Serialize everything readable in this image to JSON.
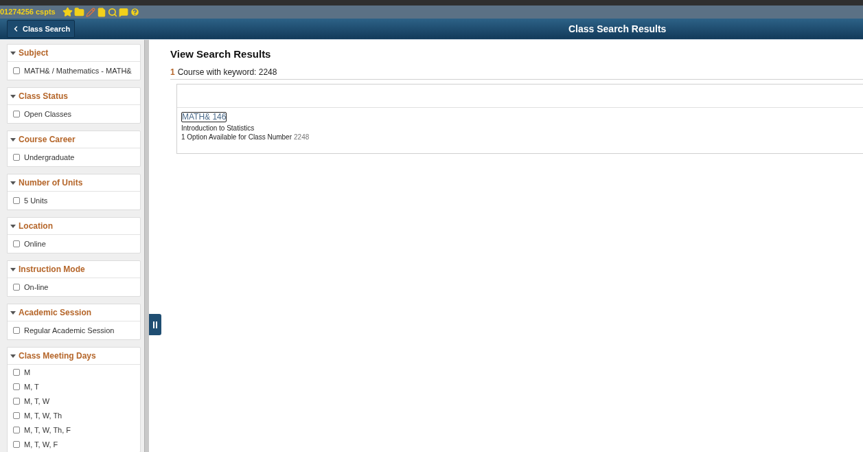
{
  "toolbar": {
    "user": "01274256 cspts"
  },
  "header": {
    "back_button": "Class Search",
    "title": "Class Search Results"
  },
  "filters": [
    {
      "title": "Subject",
      "expanded": true,
      "options": [
        {
          "label": "MATH& / Mathematics - MATH&",
          "checked": false
        }
      ]
    },
    {
      "title": "Class Status",
      "expanded": true,
      "options": [
        {
          "label": "Open Classes",
          "checked": false
        }
      ]
    },
    {
      "title": "Course Career",
      "expanded": true,
      "options": [
        {
          "label": "Undergraduate",
          "checked": false
        }
      ]
    },
    {
      "title": "Number of Units",
      "expanded": true,
      "options": [
        {
          "label": "5 Units",
          "checked": false
        }
      ]
    },
    {
      "title": "Location",
      "expanded": true,
      "options": [
        {
          "label": "Online",
          "checked": false
        }
      ]
    },
    {
      "title": "Instruction Mode",
      "expanded": true,
      "options": [
        {
          "label": "On-line",
          "checked": false
        }
      ]
    },
    {
      "title": "Academic Session",
      "expanded": true,
      "options": [
        {
          "label": "Regular Academic Session",
          "checked": false
        }
      ]
    },
    {
      "title": "Class Meeting Days",
      "expanded": true,
      "options": [
        {
          "label": "M",
          "checked": false
        },
        {
          "label": "M, T",
          "checked": false
        },
        {
          "label": "M, T, W",
          "checked": false
        },
        {
          "label": "M, T, W, Th",
          "checked": false
        },
        {
          "label": "M, T, W, Th, F",
          "checked": false
        },
        {
          "label": "M, T, W, F",
          "checked": false
        }
      ]
    }
  ],
  "results": {
    "heading": "View Search Results",
    "count": "1",
    "summary": "Course with keyword: 2248",
    "courses": [
      {
        "code": "MATH& 146",
        "title": "Introduction to Statistics",
        "options": "1 Option Available for Class Number",
        "class_number": "2248"
      }
    ]
  }
}
